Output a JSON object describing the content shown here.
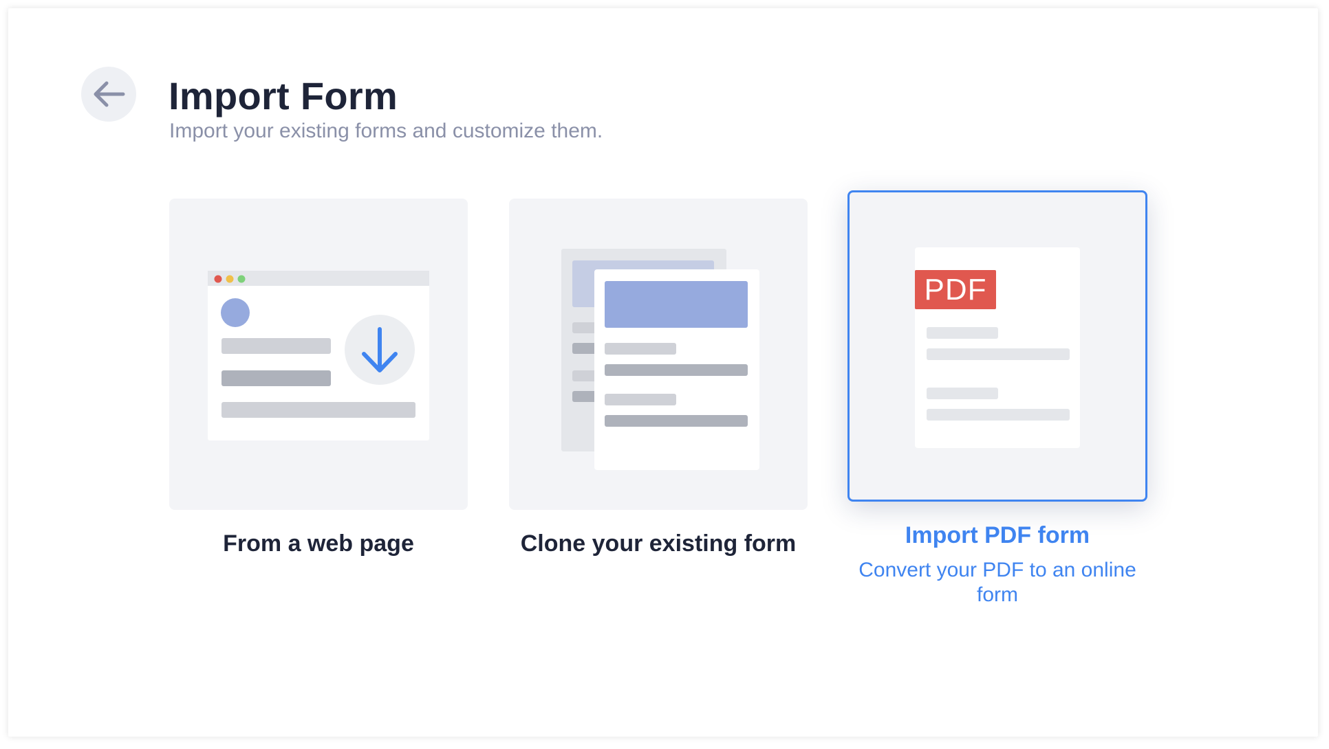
{
  "header": {
    "title": "Import Form",
    "subtitle": "Import your existing forms and customize them."
  },
  "back_button": {
    "icon": "arrow-left-icon"
  },
  "options": [
    {
      "label": "From a web page",
      "description": "",
      "selected": false,
      "icon": "web-page-download-icon"
    },
    {
      "label": "Clone your existing form",
      "description": "",
      "selected": false,
      "icon": "clone-form-icon"
    },
    {
      "label": "Import PDF form",
      "description": "Convert your PDF to an online form",
      "selected": true,
      "icon": "pdf-document-icon",
      "badge": "PDF"
    }
  ],
  "colors": {
    "accent": "#3f84f0",
    "title": "#1e2438",
    "subtitle": "#8a90a8",
    "card_bg": "#f3f4f7",
    "pdf_badge": "#e0584f"
  }
}
